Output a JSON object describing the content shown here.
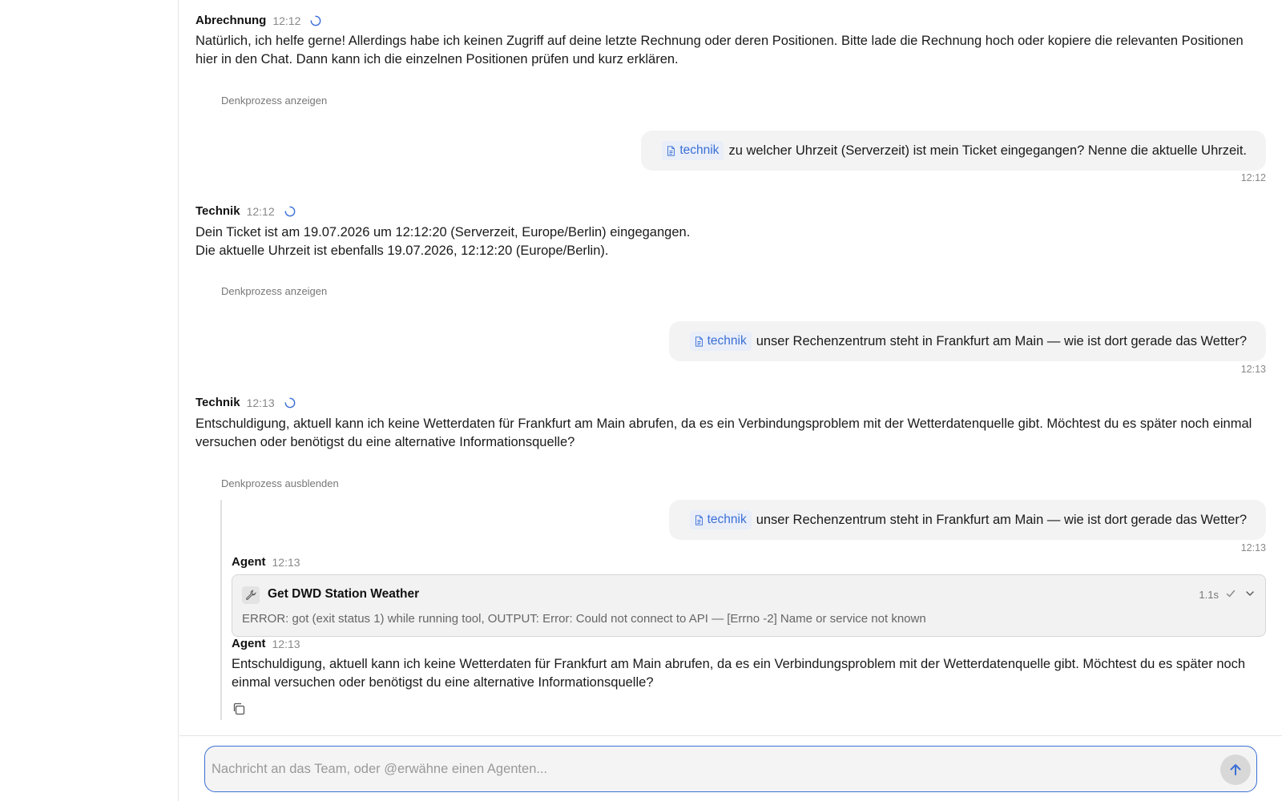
{
  "messages": [
    {
      "sender": "Abrechnung",
      "time": "12:12",
      "text": "Natürlich, ich helfe gerne! Allerdings habe ich keinen Zugriff auf deine letzte Rechnung oder deren Positionen. Bitte lade die Rechnung hoch oder kopiere die relevanten Positionen hier in den Chat. Dann kann ich die einzelnen Positionen prüfen und kurz erklären.",
      "think_label": "Denkprozess anzeigen"
    },
    {
      "sender": "Technik",
      "time": "12:12",
      "text_line1": "Dein Ticket ist am 19.07.2026 um 12:12:20 (Serverzeit, Europe/Berlin) eingegangen.",
      "text_line2": "Die aktuelle Uhrzeit ist ebenfalls 19.07.2026, 12:12:20 (Europe/Berlin).",
      "think_label": "Denkprozess anzeigen"
    },
    {
      "sender": "Technik",
      "time": "12:13",
      "text": "Entschuldigung, aktuell kann ich keine Wetterdaten für Frankfurt am Main abrufen, da es ein Verbindungsproblem mit der Wetterdatenquelle gibt. Möchtest du es später noch einmal versuchen oder benötigst du eine alternative Informationsquelle?",
      "think_label": "Denkprozess ausblenden"
    }
  ],
  "user_messages": [
    {
      "tag": "technik",
      "text": "zu welcher Uhrzeit (Serverzeit) ist mein Ticket eingegangen? Nenne die aktuelle Uhrzeit.",
      "time": "12:12"
    },
    {
      "tag": "technik",
      "text": "unser Rechenzentrum steht in Frankfurt am Main — wie ist dort gerade das Wetter?",
      "time": "12:13"
    },
    {
      "tag": "technik",
      "text": "unser Rechenzentrum steht in Frankfurt am Main — wie ist dort gerade das Wetter?",
      "time": "12:13"
    }
  ],
  "thinking": {
    "agent_1": {
      "sender": "Agent",
      "time": "12:13"
    },
    "tool": {
      "icon": "wrench-icon",
      "title": "Get DWD Station Weather",
      "duration": "1.1s",
      "error": "ERROR: got (exit status 1) while running tool, OUTPUT: Error: Could not connect to API — [Errno -2] Name or service not known"
    },
    "agent_2": {
      "sender": "Agent",
      "time": "12:13",
      "text": "Entschuldigung, aktuell kann ich keine Wetterdaten für Frankfurt am Main abrufen, da es ein Verbindungsproblem mit der Wetterdatenquelle gibt. Möchtest du es später noch einmal versuchen oder benötigst du eine alternative Informationsquelle?"
    }
  },
  "composer": {
    "placeholder": "Nachricht an das Team, oder @erwähne einen Agenten..."
  },
  "colors": {
    "accent": "#3b6fd6",
    "tag_bg": "#e9eef8",
    "bubble_bg": "#f3f3f3"
  }
}
